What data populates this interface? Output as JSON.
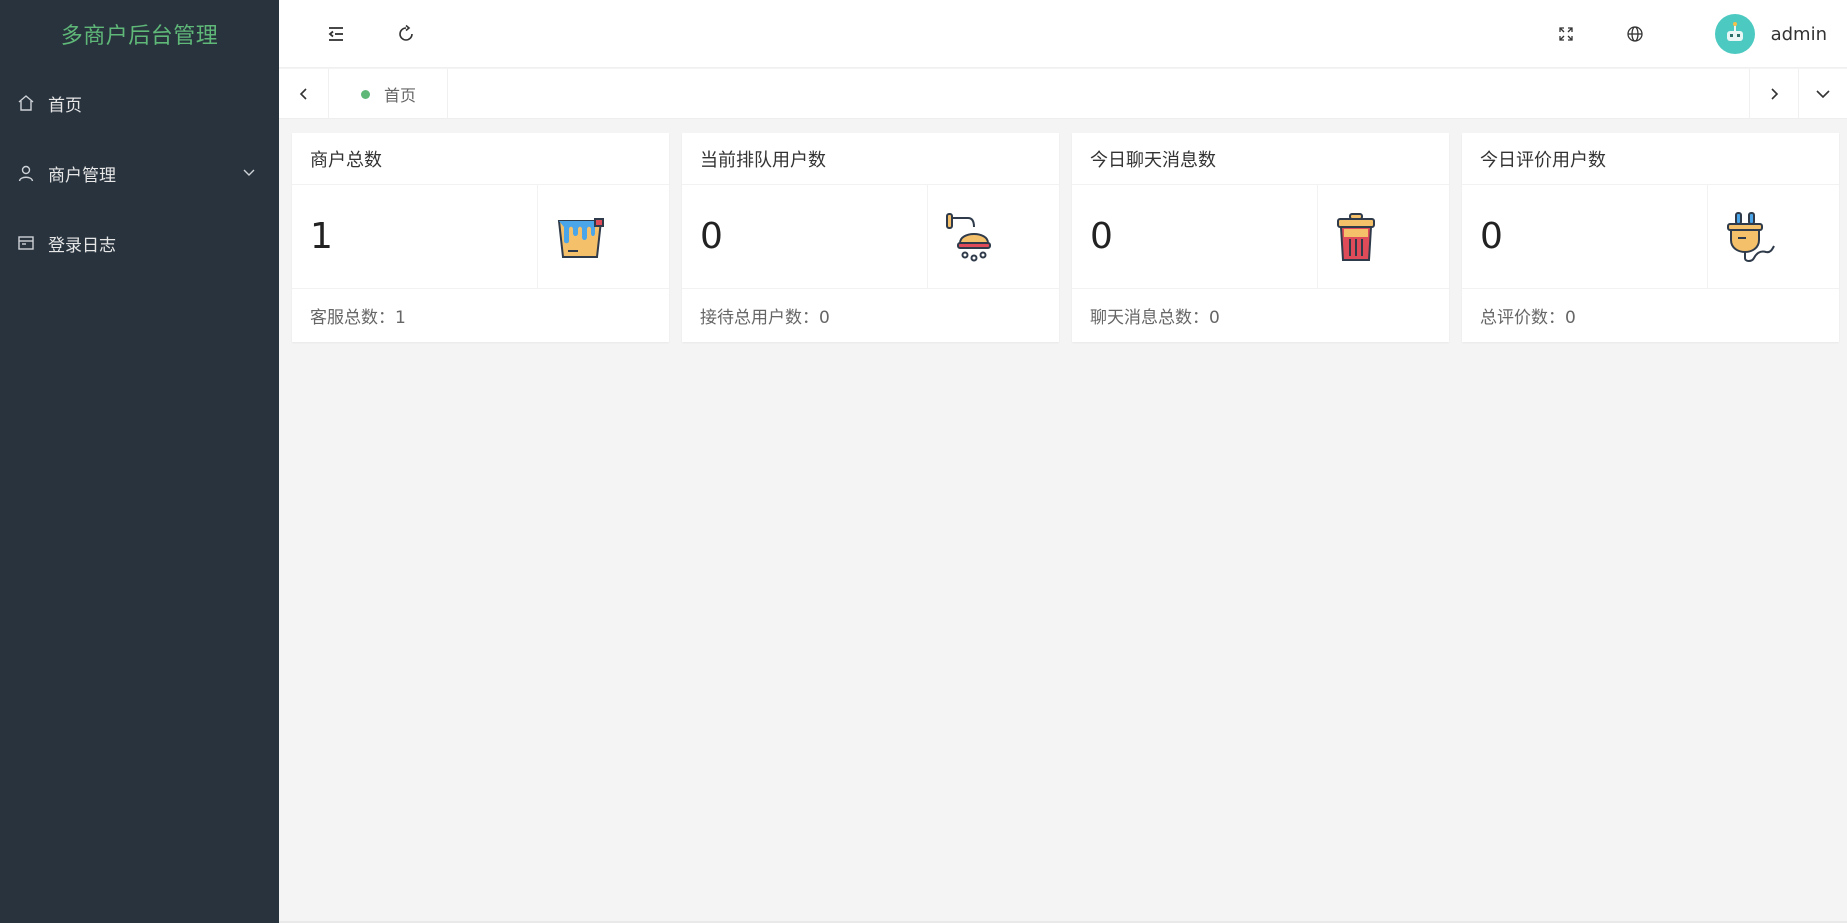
{
  "app": {
    "title": "多商户后台管理"
  },
  "sidebar": {
    "items": [
      {
        "label": "首页",
        "icon": "home-icon"
      },
      {
        "label": "商户管理",
        "icon": "user-icon",
        "expandable": true
      },
      {
        "label": "登录日志",
        "icon": "log-icon"
      }
    ]
  },
  "header": {
    "username": "admin"
  },
  "tabs": {
    "items": [
      {
        "label": "首页",
        "active": true
      }
    ]
  },
  "cards": [
    {
      "title": "商户总数",
      "value": "1",
      "footer": "客服总数：1",
      "icon": "paint-bucket-icon"
    },
    {
      "title": "当前排队用户数",
      "value": "0",
      "footer": "接待总用户数：0",
      "icon": "shower-icon"
    },
    {
      "title": "今日聊天消息数",
      "value": "0",
      "footer": "聊天消息总数：0",
      "icon": "trash-can-icon"
    },
    {
      "title": "今日评价用户数",
      "value": "0",
      "footer": "总评价数：0",
      "icon": "plug-icon"
    }
  ],
  "colors": {
    "sidebar_bg": "#28333e",
    "accent": "#5fb878",
    "page_bg": "#f4f4f4"
  }
}
